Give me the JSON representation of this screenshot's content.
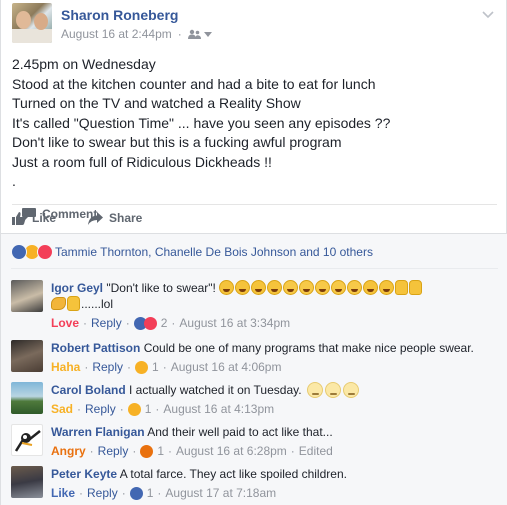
{
  "post": {
    "author": "Sharon Roneberg",
    "date": "August 16 at 2:44pm",
    "separator": "·",
    "lines": [
      "2.45pm on Wednesday",
      "Stood at the kitchen counter and had a bite to eat for lunch",
      "Turned on the TV and watched a Reality Show",
      "It's called \"Question Time\" ... have you seen any episodes ??",
      "Don't like to swear but this is a fucking awful program",
      "Just a room full of Ridiculous Dickheads !!",
      "."
    ]
  },
  "actions": {
    "like": "Like",
    "comment": "Comment",
    "share": "Share"
  },
  "reactions": {
    "summary": "Tammie Thornton, Chanelle De Bois Johnson and 10 others",
    "icons": [
      "like-icon",
      "haha-icon",
      "love-icon"
    ]
  },
  "comments": [
    {
      "name": "Igor Geyl",
      "text": "\"Don't like to swear\"!",
      "text2": "......lol",
      "reaction_label": "Love",
      "reaction_color": "#f33e58",
      "reply": "Reply",
      "count": "2",
      "time": "August 16 at 3:34pm",
      "edited": ""
    },
    {
      "name": "Robert Pattison",
      "text": "Could be one of many programs that make nice people swear.",
      "reaction_label": "Haha",
      "reaction_color": "#f7b125",
      "reply": "Reply",
      "count": "1",
      "time": "August 16 at 4:06pm",
      "edited": ""
    },
    {
      "name": "Carol Boland",
      "text": "I actually watched it on Tuesday.",
      "reaction_label": "Sad",
      "reaction_color": "#f7b125",
      "reply": "Reply",
      "count": "1",
      "time": "August 16 at 4:13pm",
      "edited": ""
    },
    {
      "name": "Warren Flanigan",
      "text": "And their well paid to act like that...",
      "reaction_label": "Angry",
      "reaction_color": "#e9710f",
      "reply": "Reply",
      "count": "1",
      "time": "August 16 at 6:28pm",
      "edited": "Edited"
    },
    {
      "name": "Peter Keyte",
      "text": "A total farce. They act like spoiled children.",
      "reaction_label": "Like",
      "reaction_color": "#4267b2",
      "reply": "Reply",
      "count": "1",
      "time": "August 17 at 7:18am",
      "edited": ""
    }
  ],
  "colors": {
    "link": "#365899",
    "muted": "#90949c",
    "comment_bg": "#f6f7f9"
  }
}
